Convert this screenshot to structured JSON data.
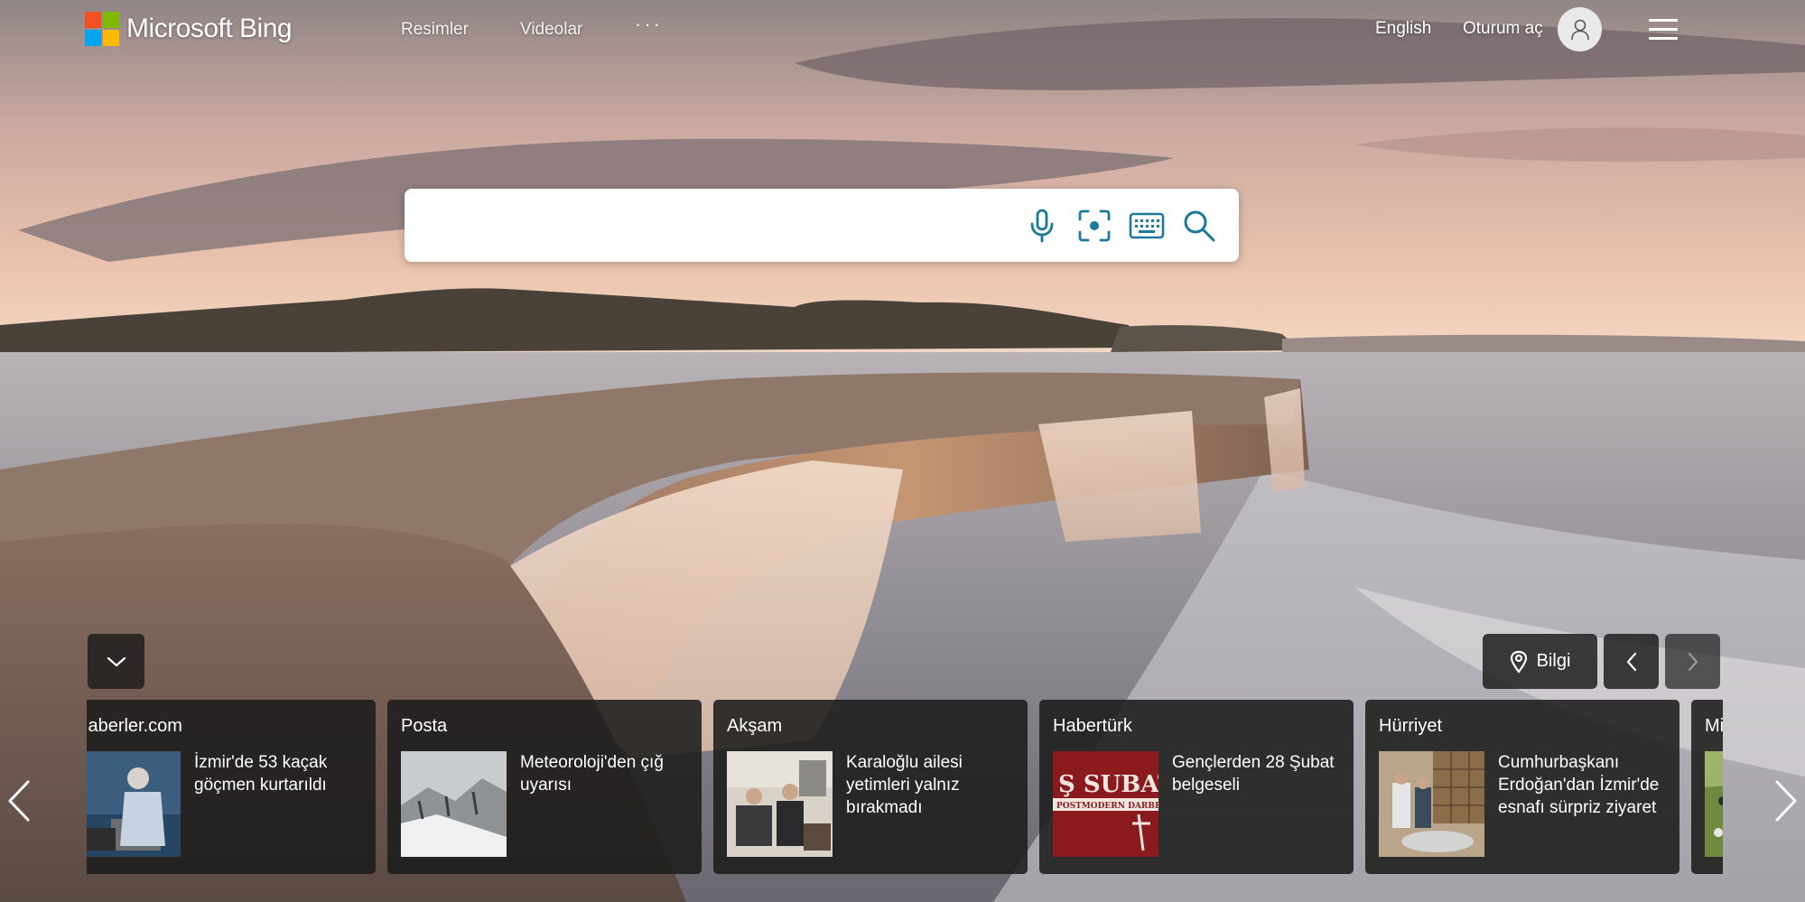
{
  "header": {
    "brand": "Microsoft Bing",
    "nav": [
      "Resimler",
      "Videolar"
    ],
    "more": "···",
    "language": "English",
    "sign_in": "Oturum aç"
  },
  "search": {
    "value": "",
    "placeholder": "",
    "icons": [
      "microphone-icon",
      "visual-search-icon",
      "keyboard-icon",
      "search-icon"
    ]
  },
  "controls": {
    "collapse_icon": "chevron-down-icon",
    "info_label": "Bilgi",
    "info_icon": "location-pin-icon",
    "prev_icon": "chevron-left-icon",
    "next_icon": "chevron-right-icon"
  },
  "news": [
    {
      "source": "Haberler.com",
      "title": "İzmir'de 53 kaçak göçmen kurtarıldı"
    },
    {
      "source": "Posta",
      "title": "Meteoroloji'den çığ uyarısı"
    },
    {
      "source": "Akşam",
      "title": "Karaloğlu ailesi yetimleri yalnız bırakmadı"
    },
    {
      "source": "Habertürk",
      "title": "Gençlerden 28 Şubat belgeseli"
    },
    {
      "source": "Hürriyet",
      "title": "Cumhurbaşkanı Erdoğan'dan İzmir'de esnafı sürpriz ziyaret"
    },
    {
      "source": "Milliyet",
      "title": ""
    }
  ],
  "thumb_texts": {
    "haberturk_main": "Ş SUBAT",
    "haberturk_sub": "POSTMODERN DARBE"
  },
  "colors": {
    "logo_red": "#f25022",
    "logo_green": "#7fba00",
    "logo_blue": "#00a4ef",
    "logo_yellow": "#ffb900",
    "search_icon": "#1a7a99",
    "card_bg": "#1c1c1c"
  }
}
